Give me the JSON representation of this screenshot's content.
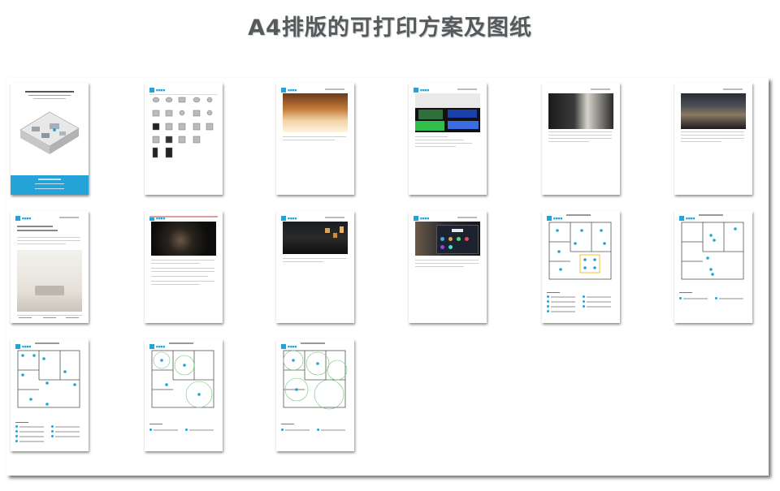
{
  "page": {
    "title": "A4排版的可打印方案及图纸"
  },
  "thumbnails": [
    {
      "kind": "cover"
    },
    {
      "kind": "product-grid"
    },
    {
      "kind": "photo",
      "scene": "bedroom-warm"
    },
    {
      "kind": "photo",
      "scene": "led-strips"
    },
    {
      "kind": "photo",
      "scene": "doorway"
    },
    {
      "kind": "photo",
      "scene": "living-room"
    },
    {
      "kind": "interior-cover"
    },
    {
      "kind": "photo",
      "scene": "dark-hand"
    },
    {
      "kind": "photo",
      "scene": "night-building"
    },
    {
      "kind": "photo",
      "scene": "smart-panel"
    },
    {
      "kind": "floorplan",
      "variant": "ceiling-lights"
    },
    {
      "kind": "floorplan",
      "variant": "sockets"
    },
    {
      "kind": "floorplan",
      "variant": "switches"
    },
    {
      "kind": "floorplan",
      "variant": "sensors"
    },
    {
      "kind": "floorplan",
      "variant": "coverage"
    }
  ],
  "colors": {
    "accent": "#23a3d8",
    "title_text": "#555a5c",
    "page_shadow": "#777777"
  }
}
